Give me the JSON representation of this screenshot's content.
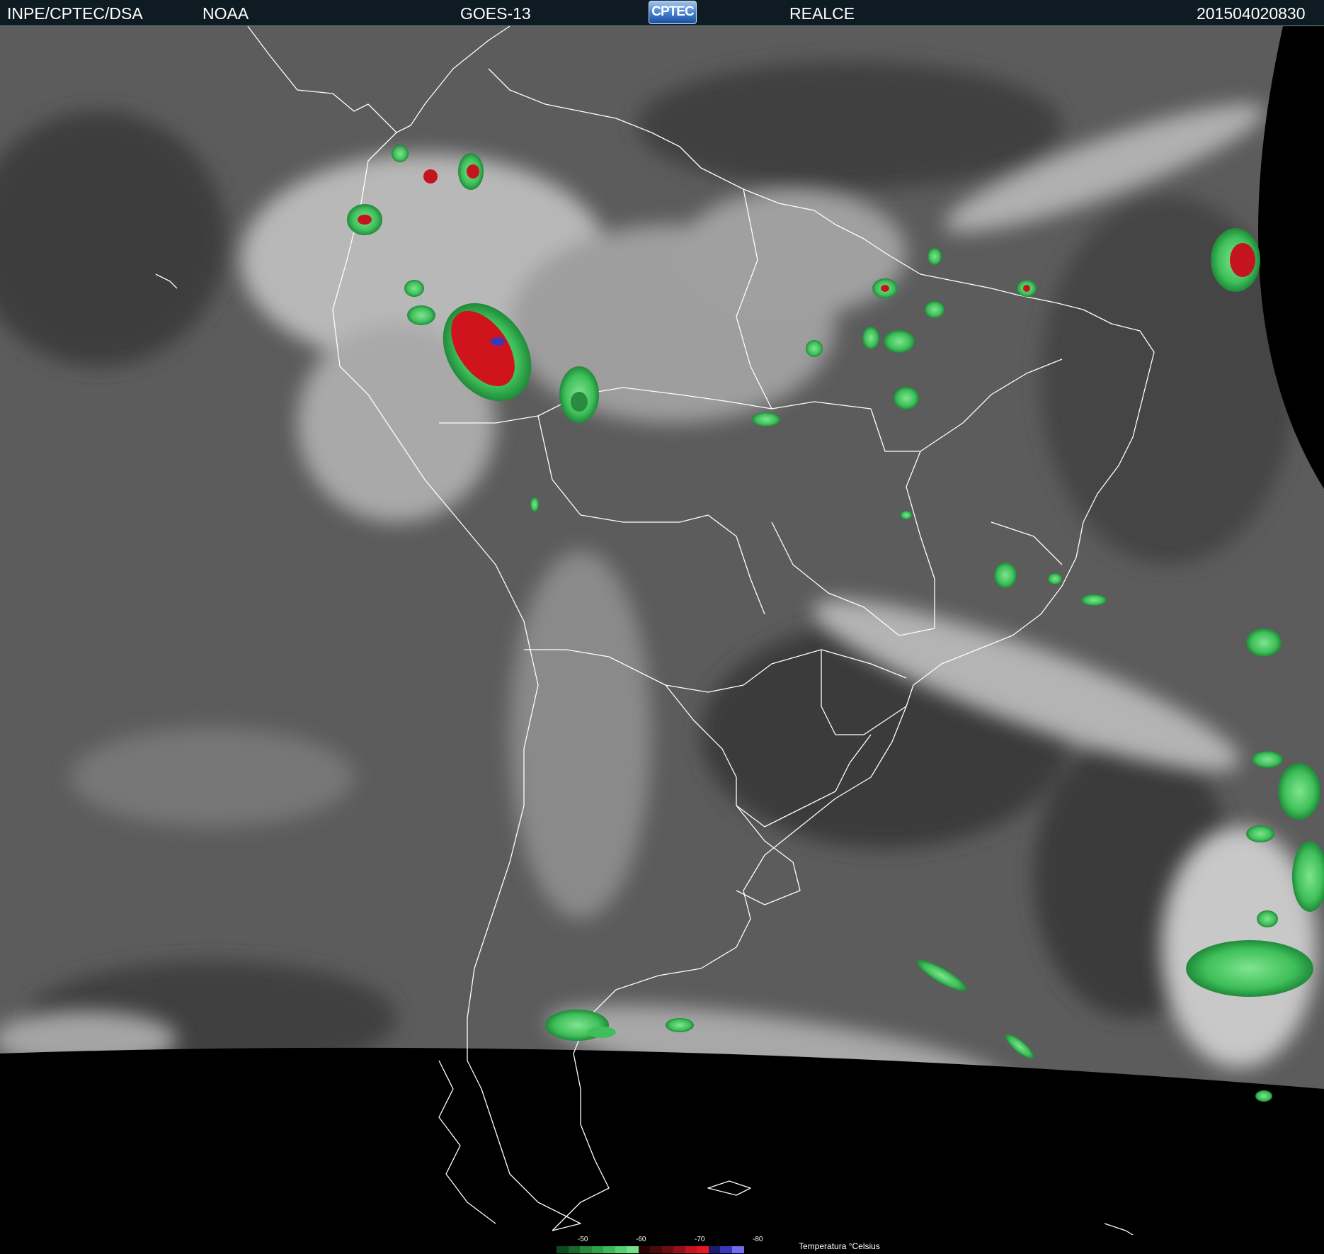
{
  "header": {
    "source": "INPE/CPTEC/DSA",
    "agency": "NOAA",
    "satellite": "GOES-13",
    "logo_text": "CPTEC",
    "product": "REALCE",
    "timestamp": "201504020830"
  },
  "legend": {
    "title": "Temperatura °Celsius",
    "tick_labels": [
      "-50",
      "-60",
      "-70",
      "-80"
    ],
    "colors": [
      "#0b4a1e",
      "#16682b",
      "#238a3a",
      "#2fa248",
      "#3eb859",
      "#55cf70",
      "#74e08a",
      "#2a0508",
      "#4a0a0c",
      "#6e0d10",
      "#94101a",
      "#c4141f",
      "#e8161f",
      "#1d1b6e",
      "#3a38b8",
      "#6e6cf0"
    ]
  },
  "colors": {
    "header_bg": "#0f1b22",
    "coastline": "#ffffff",
    "cold_cloud_green": "#3fbf5a",
    "very_cold_red": "#d0141d",
    "coldest_blue": "#3a38b8"
  }
}
